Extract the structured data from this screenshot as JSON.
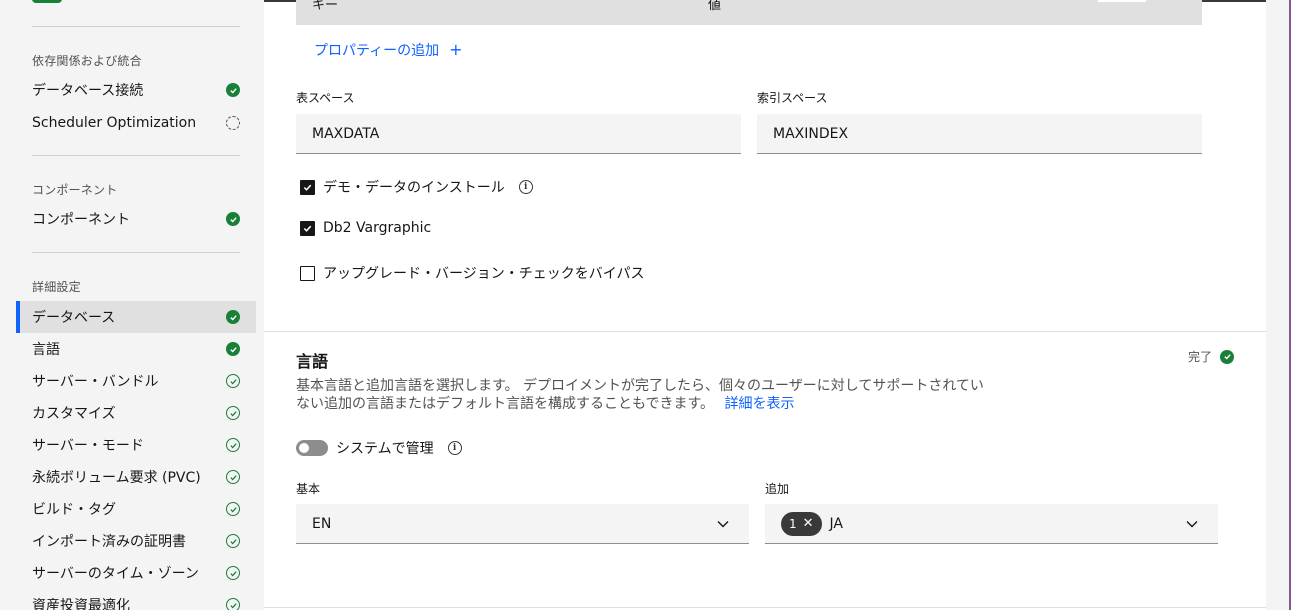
{
  "sidebar": {
    "sections": [
      {
        "heading": "依存関係および統合",
        "items": [
          {
            "label": "データベース接続",
            "status": "filled"
          },
          {
            "label": "Scheduler Optimization",
            "status": "dashed"
          }
        ]
      },
      {
        "heading": "コンポーネント",
        "items": [
          {
            "label": "コンポーネント",
            "status": "filled"
          }
        ]
      },
      {
        "heading": "詳細設定",
        "items": [
          {
            "label": "データベース",
            "status": "filled",
            "active": true
          },
          {
            "label": "言語",
            "status": "filled"
          },
          {
            "label": "サーバー・バンドル",
            "status": "outline"
          },
          {
            "label": "カスタマイズ",
            "status": "outline"
          },
          {
            "label": "サーバー・モード",
            "status": "outline"
          },
          {
            "label": "永続ボリューム要求 (PVC)",
            "status": "outline"
          },
          {
            "label": "ビルド・タグ",
            "status": "outline"
          },
          {
            "label": "インポート済みの証明書",
            "status": "outline"
          },
          {
            "label": "サーバーのタイム・ゾーン",
            "status": "outline"
          },
          {
            "label": "資産投資最適化",
            "status": "outline"
          }
        ]
      }
    ]
  },
  "properties_table": {
    "col_key": "キー",
    "col_value": "値"
  },
  "add_property": {
    "label": "プロパティーの追加",
    "icon": "plus-icon"
  },
  "database": {
    "tablespace_label": "表スペース",
    "tablespace_value": "MAXDATA",
    "indexspace_label": "索引スペース",
    "indexspace_value": "MAXINDEX",
    "install_demo_label": "デモ・データのインストール",
    "install_demo_checked": true,
    "vargraphic_label": "Db2 Vargraphic",
    "vargraphic_checked": true,
    "bypass_upgrade_label": "アップグレード・バージョン・チェックをバイパス",
    "bypass_upgrade_checked": false
  },
  "language": {
    "title": "言語",
    "status_label": "完了",
    "description": "基本言語と追加言語を選択します。 デプロイメントが完了したら、個々のユーザーに対してサポートされていない追加の言語またはデフォルト言語を構成することもできます。",
    "learn_more": "詳細を表示",
    "system_managed_label": "システムで管理",
    "system_managed_on": false,
    "base_label": "基本",
    "base_value": "EN",
    "additional_label": "追加",
    "additional_count": "1",
    "additional_value": "JA"
  },
  "colors": {
    "accent": "#0f62fe",
    "success": "#198038"
  }
}
